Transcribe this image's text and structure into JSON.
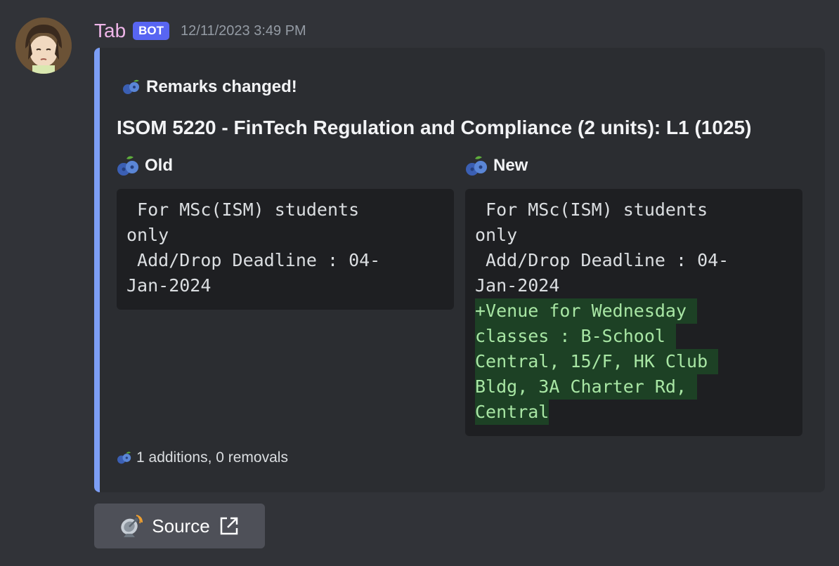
{
  "message": {
    "author": "Tab",
    "bot_tag": "BOT",
    "timestamp": "12/11/2023 3:49 PM"
  },
  "embed": {
    "accent_color": "#7c9ef5",
    "title": "Remarks changed!",
    "title_icon": "blueberries-icon",
    "description": "ISOM 5220 - FinTech Regulation and Compliance (2 units): L1 (1025)",
    "fields": [
      {
        "name": "Old",
        "icon": "blueberries-icon",
        "lines": [
          " For MSc(ISM) students",
          "only",
          " Add/Drop Deadline : 04-",
          "Jan-2024"
        ]
      },
      {
        "name": "New",
        "icon": "blueberries-icon",
        "lines": [
          " For MSc(ISM) students",
          "only",
          " Add/Drop Deadline : 04-",
          "Jan-2024"
        ],
        "added_lines": [
          "+Venue for Wednesday ",
          "classes : B-School ",
          "Central, 15/F, HK Club ",
          "Bldg, 3A Charter Rd, ",
          "Central"
        ]
      }
    ],
    "footer": "1 additions, 0 removals"
  },
  "button": {
    "label": "Source",
    "icon": "satellite-antenna-icon",
    "trailing_icon": "external-link-icon"
  }
}
